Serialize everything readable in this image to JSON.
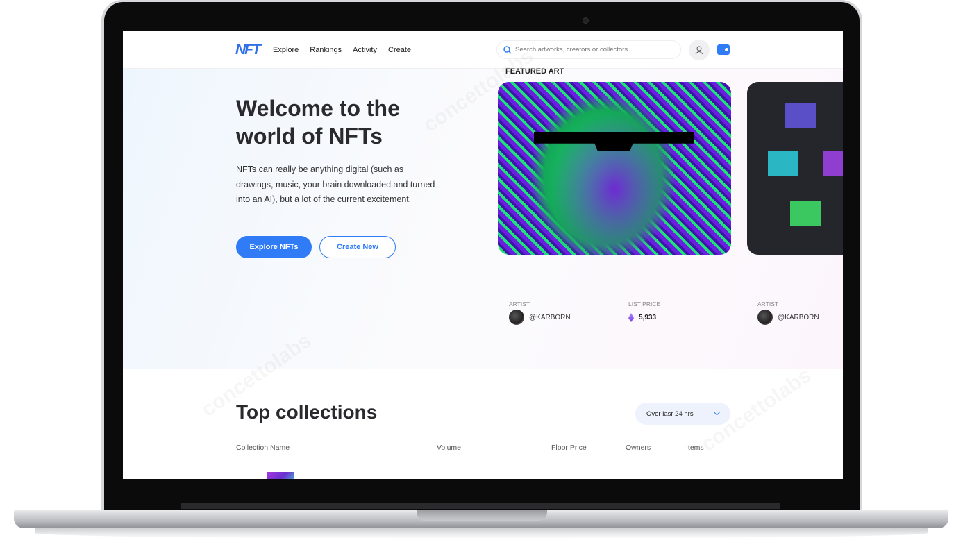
{
  "nav": {
    "logo": "NFT",
    "links": [
      "Explore",
      "Rankings",
      "Activity",
      "Create"
    ],
    "search_placeholder": "Search artworks, creators or collectors..."
  },
  "hero": {
    "title": "Welcome to the world of NFTs",
    "description": "NFTs can really be anything digital (such as drawings, music, your brain downloaded and turned into an AI), but a lot of the current excitement.",
    "primary_button": "Explore NFTs",
    "secondary_button": "Create New"
  },
  "featured": {
    "heading": "FEATURED ART",
    "cards": [
      {
        "artist_label": "ARTIST",
        "artist": "@KARBORN",
        "price_label": "LIST PRICE",
        "price": "5,933",
        "currency_icon": "ethereum-icon"
      },
      {
        "artist_label": "ARTIST",
        "artist": "@KARBORN"
      }
    ]
  },
  "collections": {
    "title": "Top collections",
    "period": "Over lasr 24 hrs",
    "columns": [
      "Collection Name",
      "Volume",
      "Floor Price",
      "Owners",
      "Items"
    ]
  },
  "watermark": "concettolabs",
  "colors": {
    "accent": "#2f7cf6",
    "text": "#2a2a2e"
  }
}
